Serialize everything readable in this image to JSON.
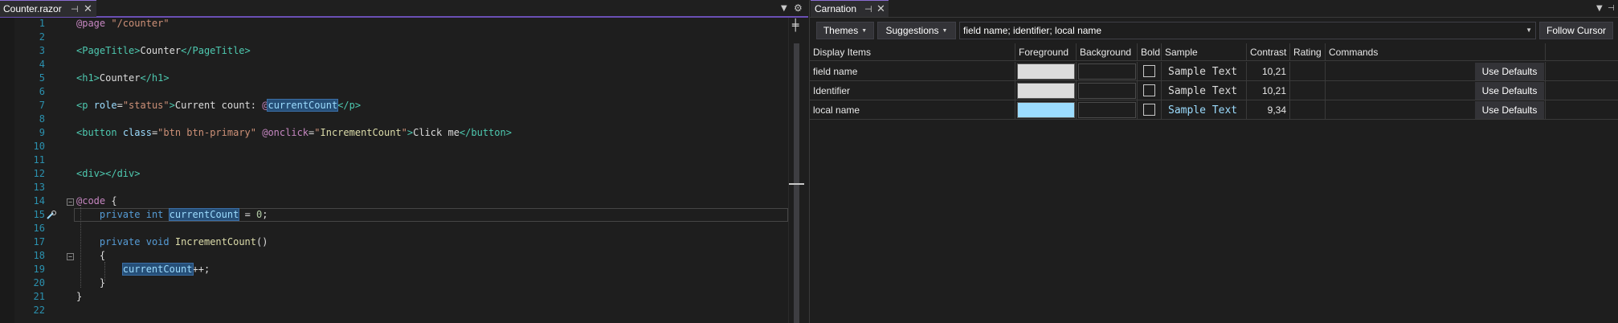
{
  "editor": {
    "tab_label": "Counter.razor",
    "line_numbers": [
      "1",
      "2",
      "3",
      "4",
      "5",
      "6",
      "7",
      "8",
      "9",
      "10",
      "11",
      "12",
      "13",
      "14",
      "15",
      "16",
      "17",
      "18",
      "19",
      "20",
      "21",
      "22"
    ]
  },
  "carnation": {
    "tab_label": "Carnation",
    "themes_label": "Themes",
    "suggestions_label": "Suggestions",
    "selection_value": "field name; identifier; local name",
    "follow_cursor_label": "Follow Cursor",
    "columns": [
      "Display Items",
      "Foreground",
      "Background",
      "Bold",
      "Sample",
      "Contrast",
      "Rating",
      "Commands"
    ],
    "rows": [
      {
        "name": "field name",
        "fg": "#dcdcdc",
        "sample": "Sample Text",
        "sample_color": "#dcdcdc",
        "contrast": "10,21",
        "rating": "",
        "button": "Use Defaults"
      },
      {
        "name": "Identifier",
        "fg": "#dcdcdc",
        "sample": "Sample Text",
        "sample_color": "#dcdcdc",
        "contrast": "10,21",
        "rating": "",
        "button": "Use Defaults"
      },
      {
        "name": "local name",
        "fg": "#9cdcfe",
        "sample": "Sample Text",
        "sample_color": "#9cdcfe",
        "contrast": "9,34",
        "rating": "",
        "button": "Use Defaults"
      }
    ]
  },
  "colors": {
    "accent": "#8a6bd2",
    "highlight": "#264f78"
  }
}
